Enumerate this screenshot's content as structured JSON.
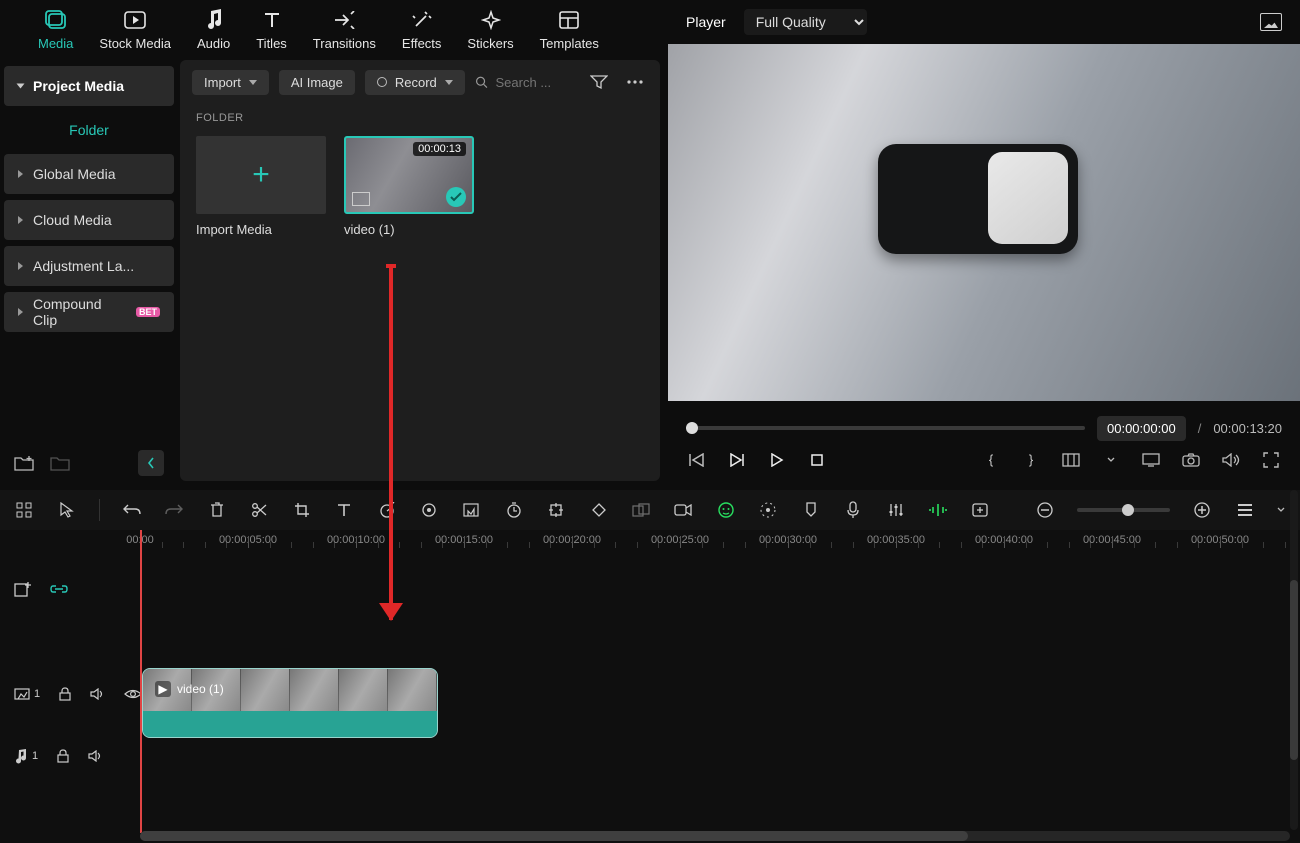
{
  "top_tabs": {
    "media": "Media",
    "stock_media": "Stock Media",
    "audio": "Audio",
    "titles": "Titles",
    "transitions": "Transitions",
    "effects": "Effects",
    "stickers": "Stickers",
    "templates": "Templates"
  },
  "sidebar": {
    "project_media": "Project Media",
    "folder": "Folder",
    "global_media": "Global Media",
    "cloud_media": "Cloud Media",
    "adjustment_layer": "Adjustment La...",
    "compound_clip": "Compound Clip",
    "beta_badge": "BET"
  },
  "media_toolbar": {
    "import": "Import",
    "ai_image": "AI Image",
    "record": "Record",
    "search_placeholder": "Search ..."
  },
  "media_body": {
    "folder_heading": "FOLDER",
    "import_media": "Import Media",
    "clip_duration": "00:00:13",
    "clip_name": "video (1)"
  },
  "player": {
    "label": "Player",
    "quality": "Full Quality",
    "current_time": "00:00:00:00",
    "separator": "/",
    "total_time": "00:00:13:20"
  },
  "timeline": {
    "ruler": [
      "00:00",
      "00:00:05:00",
      "00:00:10:00",
      "00:00:15:00",
      "00:00:20:00",
      "00:00:25:00",
      "00:00:30:00",
      "00:00:35:00",
      "00:00:40:00",
      "00:00:45:00",
      "00:00:50:00"
    ],
    "video_track_index": "1",
    "audio_track_index": "1",
    "clip_label": "video (1)"
  }
}
